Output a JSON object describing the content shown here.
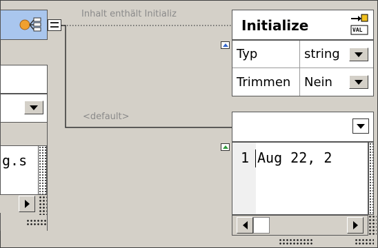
{
  "connectors": {
    "top_label": "Inhalt enthält Initializ",
    "bottom_label": "<default>"
  },
  "initialize_node": {
    "title": "Initialize",
    "badge": "VAL",
    "rows": [
      {
        "label": "Typ",
        "value": "string"
      },
      {
        "label": "Trimmen",
        "value": "Nein"
      }
    ]
  },
  "left_node": {
    "value_fragment": "g.s"
  },
  "editor": {
    "line_number": "1",
    "text": "Aug 22, 2"
  },
  "colors": {
    "canvas": "#d4d0c8",
    "node_header": "#a9c6ee",
    "connector_port": "#ffffff",
    "expand_marker_blue": "#3366cc",
    "expand_marker_green": "#2e9a3a"
  }
}
